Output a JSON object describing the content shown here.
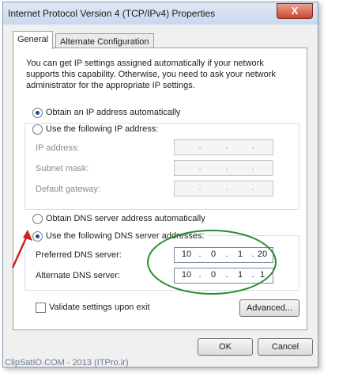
{
  "window": {
    "title": "Internet Protocol Version 4 (TCP/IPv4) Properties",
    "close_label": "X"
  },
  "tabs": [
    {
      "label": "General",
      "active": true
    },
    {
      "label": "Alternate Configuration",
      "active": false
    }
  ],
  "intro_text": "You can get IP settings assigned automatically if your network supports this capability. Otherwise, you need to ask your network administrator for the appropriate IP settings.",
  "ip_settings": {
    "auto_label": "Obtain an IP address automatically",
    "manual_label": "Use the following IP address:",
    "fields": [
      {
        "label": "IP address:",
        "octets": [
          "",
          "",
          "",
          ""
        ]
      },
      {
        "label": "Subnet mask:",
        "octets": [
          "",
          "",
          "",
          ""
        ]
      },
      {
        "label": "Default gateway:",
        "octets": [
          "",
          "",
          "",
          ""
        ]
      }
    ]
  },
  "dns_settings": {
    "auto_label": "Obtain DNS server address automatically",
    "manual_label": "Use the following DNS server addresses:",
    "preferred": {
      "label": "Preferred DNS server:",
      "octets": [
        "10",
        "0",
        "1",
        "20"
      ]
    },
    "alternate": {
      "label": "Alternate DNS server:",
      "octets": [
        "10",
        "0",
        "1",
        "1"
      ]
    }
  },
  "validate_label": "Validate settings upon exit",
  "buttons": {
    "advanced": "Advanced...",
    "ok": "OK",
    "cancel": "Cancel"
  },
  "watermark": "ClipSatIO.COM - 2013 (ITPro.ir)",
  "colors": {
    "highlight_ellipse": "#2b8a2b",
    "arrow": "#cc2222"
  }
}
